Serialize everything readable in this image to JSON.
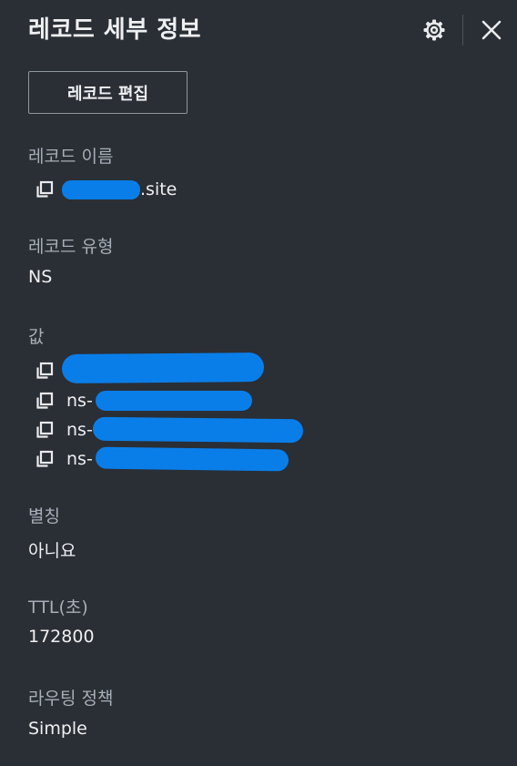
{
  "header": {
    "title": "레코드 세부 정보",
    "settings_icon": "gear-icon",
    "close_icon": "close-icon"
  },
  "actions": {
    "edit_label": "레코드 편집"
  },
  "record_name": {
    "label": "레코드 이름",
    "value": ".site"
  },
  "record_type": {
    "label": "레코드 유형",
    "value": "NS"
  },
  "values": {
    "label": "값",
    "items": [
      "",
      "ns-",
      "ns-",
      "ns-"
    ]
  },
  "alias": {
    "label": "별칭",
    "value": "아니요"
  },
  "ttl": {
    "label": "TTL(초)",
    "value": "172800"
  },
  "routing_policy": {
    "label": "라우팅 정책",
    "value": "Simple"
  },
  "colors": {
    "background": "#2a2e35",
    "text": "#eef0f2",
    "label": "#a7afb8",
    "redaction": "#0a7ee8"
  }
}
